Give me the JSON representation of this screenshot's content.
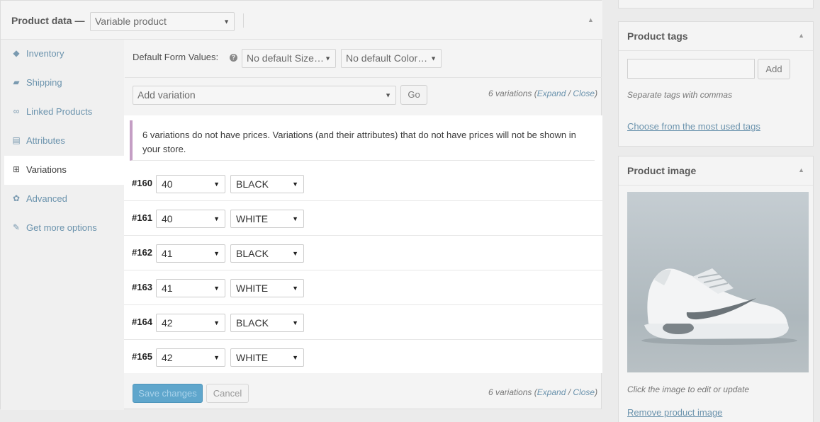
{
  "product_data": {
    "title": "Product data —",
    "type_select": "Variable product",
    "tabs": [
      {
        "label": "Inventory",
        "icon": "tag-icon"
      },
      {
        "label": "Shipping",
        "icon": "truck-icon"
      },
      {
        "label": "Linked Products",
        "icon": "link-icon"
      },
      {
        "label": "Attributes",
        "icon": "list-icon"
      },
      {
        "label": "Variations",
        "icon": "grid-icon",
        "active": true
      },
      {
        "label": "Advanced",
        "icon": "gear-icon"
      },
      {
        "label": "Get more options",
        "icon": "plug-icon"
      }
    ],
    "default_form_label": "Default Form Values:",
    "default_size": "No default Size…",
    "default_color": "No default Color…",
    "add_variation": "Add variation",
    "go_label": "Go",
    "count_text_pre": "6 variations (",
    "expand": "Expand",
    "slash": " / ",
    "close": "Close",
    "count_text_post": ")",
    "notice": "6 variations do not have prices. Variations (and their attributes) that do not have prices will not be shown in your store.",
    "variations": [
      {
        "id": "#160",
        "size": "40",
        "color": "BLACK"
      },
      {
        "id": "#161",
        "size": "40",
        "color": "WHITE"
      },
      {
        "id": "#162",
        "size": "41",
        "color": "BLACK"
      },
      {
        "id": "#163",
        "size": "41",
        "color": "WHITE"
      },
      {
        "id": "#164",
        "size": "42",
        "color": "BLACK"
      },
      {
        "id": "#165",
        "size": "42",
        "color": "WHITE"
      }
    ],
    "save_label": "Save changes",
    "cancel_label": "Cancel"
  },
  "product_tags": {
    "title": "Product tags",
    "add_label": "Add",
    "hint": "Separate tags with commas",
    "link": "Choose from the most used tags"
  },
  "product_image": {
    "title": "Product image",
    "hint": "Click the image to edit or update",
    "remove_link": "Remove product image"
  },
  "colors": {
    "accent_link": "#6b93ad",
    "primary_button": "#5fa6cc",
    "notice_border": "#c49ec4"
  }
}
